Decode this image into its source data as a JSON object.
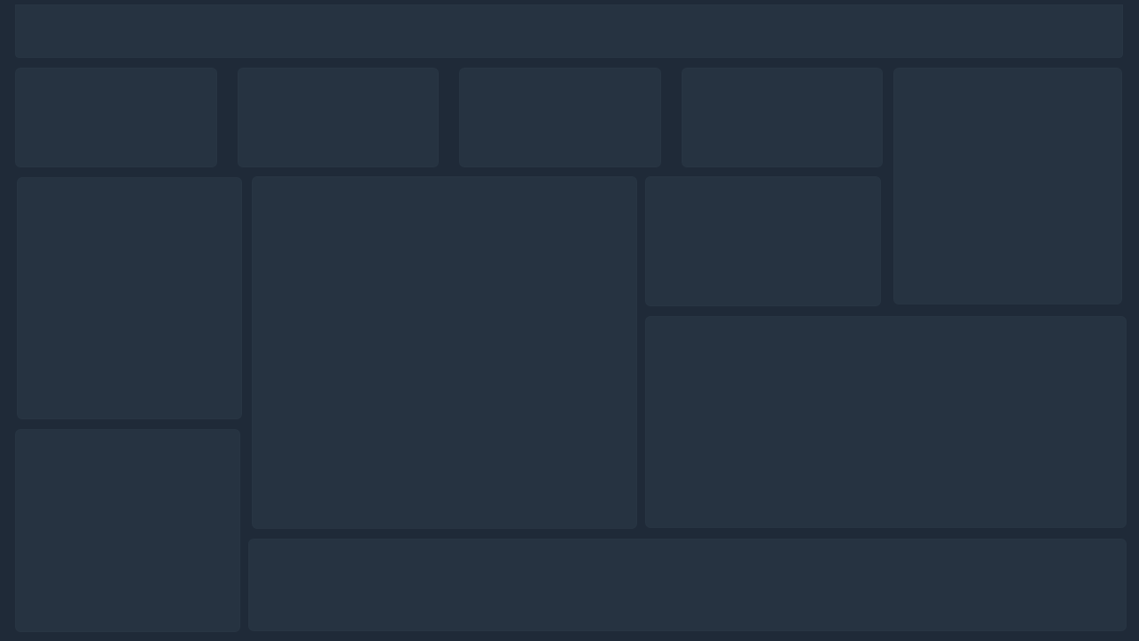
{
  "theme": {
    "background": "#1f2a38",
    "panel": "#263341"
  },
  "dashboard": {
    "panels": [
      {
        "id": "header-bar",
        "label": ""
      },
      {
        "id": "stat-card-1",
        "label": ""
      },
      {
        "id": "stat-card-2",
        "label": ""
      },
      {
        "id": "stat-card-3",
        "label": ""
      },
      {
        "id": "stat-card-4",
        "label": ""
      },
      {
        "id": "right-summary-panel",
        "label": ""
      },
      {
        "id": "left-panel-top",
        "label": ""
      },
      {
        "id": "main-chart-panel",
        "label": ""
      },
      {
        "id": "small-panel-right",
        "label": ""
      },
      {
        "id": "wide-panel-right",
        "label": ""
      },
      {
        "id": "left-panel-bottom",
        "label": ""
      },
      {
        "id": "bottom-strip-panel",
        "label": ""
      }
    ]
  }
}
